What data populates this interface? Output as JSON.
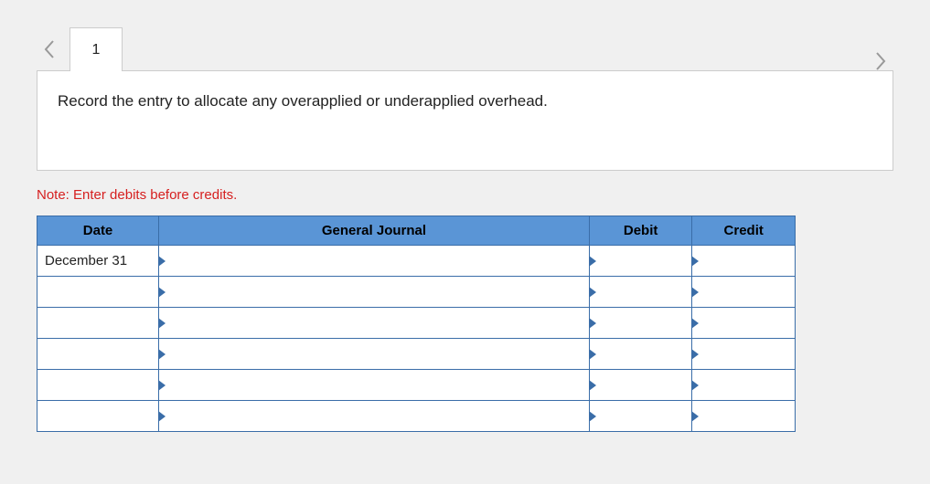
{
  "nav": {
    "tab_label": "1"
  },
  "instruction": "Record the entry to allocate any overapplied or underapplied overhead.",
  "note": "Note: Enter debits before credits.",
  "table": {
    "headers": {
      "date": "Date",
      "journal": "General Journal",
      "debit": "Debit",
      "credit": "Credit"
    },
    "rows": [
      {
        "date": "December 31",
        "journal": "",
        "debit": "",
        "credit": ""
      },
      {
        "date": "",
        "journal": "",
        "debit": "",
        "credit": ""
      },
      {
        "date": "",
        "journal": "",
        "debit": "",
        "credit": ""
      },
      {
        "date": "",
        "journal": "",
        "debit": "",
        "credit": ""
      },
      {
        "date": "",
        "journal": "",
        "debit": "",
        "credit": ""
      },
      {
        "date": "",
        "journal": "",
        "debit": "",
        "credit": ""
      }
    ]
  }
}
